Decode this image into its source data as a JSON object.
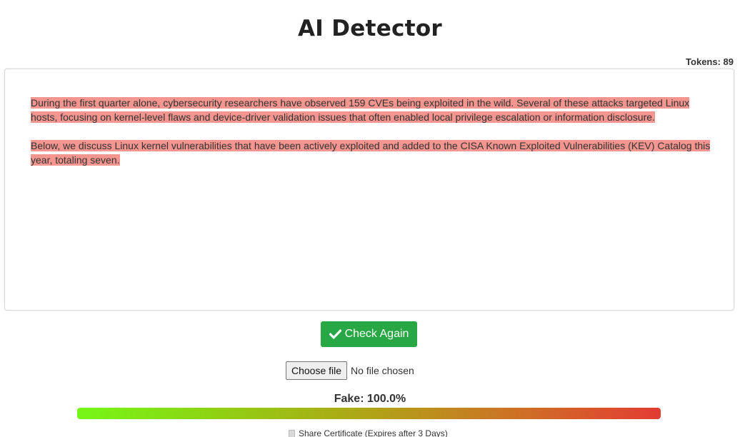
{
  "header": {
    "title": "AI Detector",
    "tokens_label": "Tokens: 89"
  },
  "analysis": {
    "paragraphs": [
      "During the first quarter alone, cybersecurity researchers have observed 159 CVEs being exploited in the wild. Several of these attacks targeted Linux hosts, focusing on kernel-level flaws and device-driver validation issues that often enabled local privilege escalation or information disclosure.",
      "Below, we discuss Linux kernel vulnerabilities that have been actively exploited and added to the CISA Known Exploited Vulnerabilities (KEV) Catalog this year, totaling seven."
    ],
    "highlight_color": "#f5958f"
  },
  "actions": {
    "check_again_label": "Check Again",
    "check_again_icon": "check-icon",
    "check_again_color": "#28a745",
    "choose_file_label": "Choose file",
    "no_file_label": "No file chosen"
  },
  "result": {
    "fake_label": "Fake: 100.0%",
    "fake_fraction": 1.0,
    "bar_colors": [
      "#76f716",
      "#e43b33"
    ]
  },
  "share": {
    "icon": "document-icon",
    "label": "Share Certificate (Expires after 3 Days)"
  }
}
